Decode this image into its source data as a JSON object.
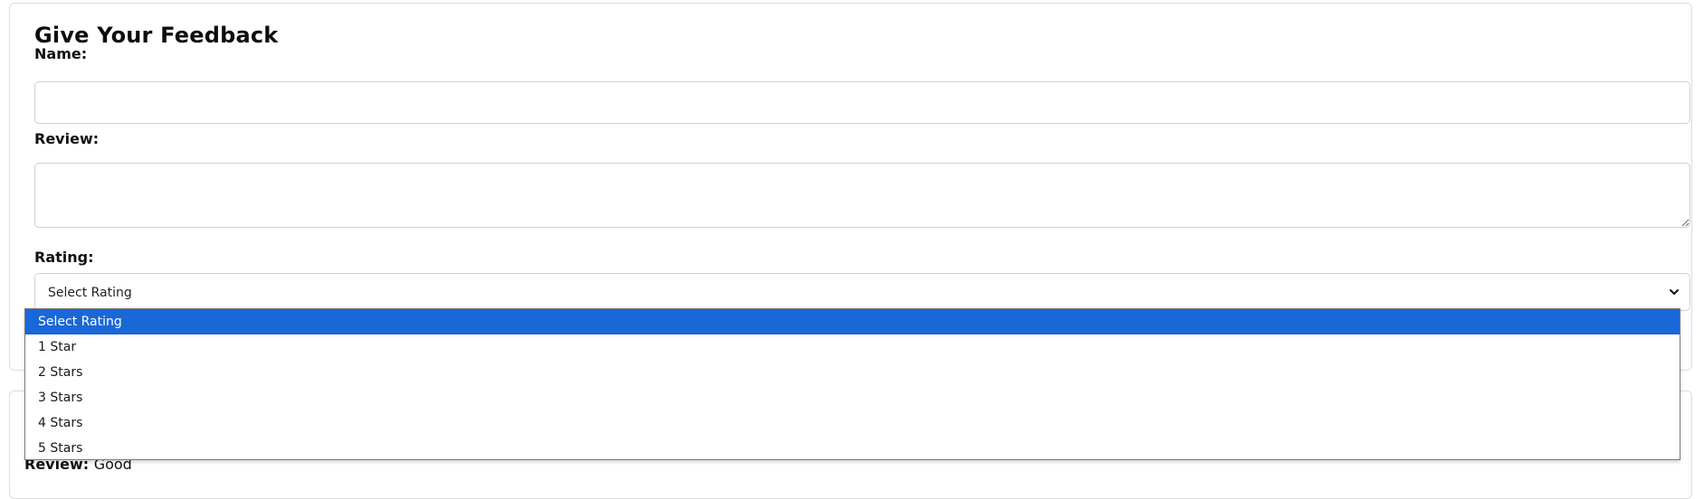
{
  "form": {
    "title": "Give Your Feedback",
    "name_label": "Name:",
    "name_value": "",
    "review_label": "Review:",
    "review_value": "",
    "rating_label": "Rating:",
    "rating_selected": "Select Rating",
    "rating_options": [
      "Select Rating",
      "1 Star",
      "2 Stars",
      "3 Stars",
      "4 Stars",
      "5 Stars"
    ],
    "highlighted_option_index": 0
  },
  "below_card": {
    "review_label": "Review:",
    "review_value": "Good"
  },
  "colors": {
    "highlight": "#1a67d8",
    "border": "#cfcfcf"
  },
  "icons": {
    "select_indicator": "chevron-down-icon",
    "textarea_resize": "resize-grip-icon"
  }
}
